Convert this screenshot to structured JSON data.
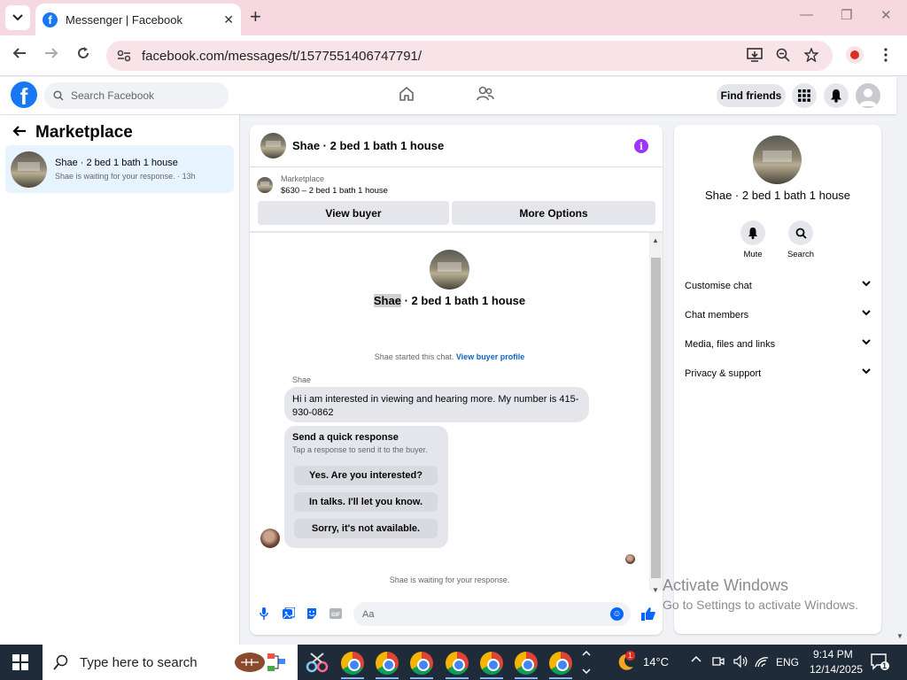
{
  "browser": {
    "tab_title": "Messenger | Facebook",
    "url": "facebook.com/messages/t/1577551406747791/"
  },
  "fb_header": {
    "search_placeholder": "Search Facebook",
    "find_friends": "Find friends"
  },
  "left_panel": {
    "title": "Marketplace",
    "conversations": [
      {
        "name": "Shae · 2 bed 1 bath 1 house",
        "subtitle": "Shae is waiting for your response. · 13h"
      }
    ]
  },
  "chat": {
    "header_name": "Shae · 2 bed 1 bath 1 house",
    "listing_label": "Marketplace",
    "listing_detail": "$630 – 2 bed 1 bath 1 house",
    "view_buyer": "View buyer",
    "more_options": "More Options",
    "center_name_first": "Shae",
    "center_name_rest": " · 2 bed 1 bath 1 house",
    "started_text": "Shae started this chat. ",
    "view_buyer_profile": "View buyer profile",
    "sender_name": "Shae",
    "message": "Hi i am interested in viewing and hearing more. My number is 415-930-0862",
    "quick_response_title": "Send a quick response",
    "quick_response_sub": "Tap a response to send it to the buyer.",
    "quick_responses": [
      "Yes. Are you interested?",
      "In talks. I'll let you know.",
      "Sorry, it's not available."
    ],
    "waiting": "Shae is waiting for your response.",
    "input_placeholder": "Aa"
  },
  "right_panel": {
    "name": "Shae · 2 bed 1 bath 1 house",
    "actions": [
      "Mute",
      "Search"
    ],
    "sections": [
      "Customise chat",
      "Chat members",
      "Media, files and links",
      "Privacy & support"
    ]
  },
  "watermark": {
    "line1": "Activate Windows",
    "line2": "Go to Settings to activate Windows."
  },
  "taskbar": {
    "search_placeholder": "Type here to search",
    "weather": "14°C",
    "weather_badge": "1",
    "language": "ENG",
    "time": "9:14 PM",
    "date": "12/14/2025",
    "notifications": "1"
  },
  "colors": {
    "fb_blue": "#1877f2",
    "messenger_blue": "#0866ff",
    "selected_bg": "#e7f3ff",
    "info_purple": "#a033ff",
    "tab_strip": "#f6d9e0"
  }
}
